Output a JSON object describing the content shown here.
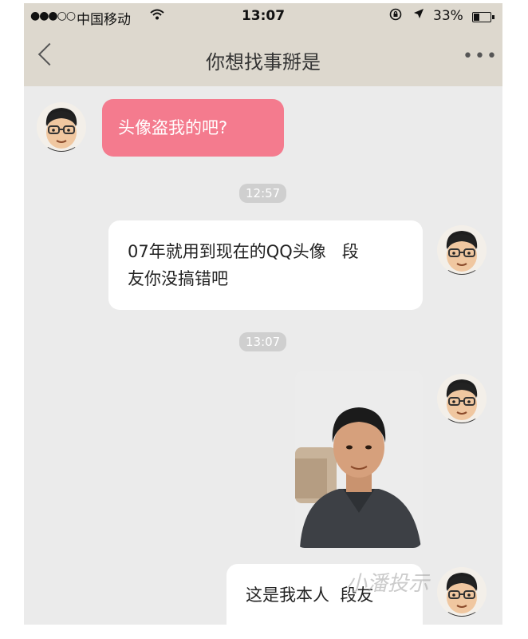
{
  "status_bar": {
    "signal": "●●●○○",
    "carrier": "中国移动",
    "time": "13:07",
    "battery": "33%",
    "battery_level": 0.33
  },
  "nav": {
    "title": "你想找事掰是"
  },
  "messages": [
    {
      "side": "left",
      "type": "text",
      "text": "头像盗我的吧?"
    },
    {
      "type": "timestamp",
      "text": "12:57"
    },
    {
      "side": "right",
      "type": "text",
      "line1": "07年就用到现在的QQ头像   段",
      "line2": "友你没搞错吧"
    },
    {
      "type": "timestamp",
      "text": "13:07"
    },
    {
      "side": "right",
      "type": "image"
    },
    {
      "side": "right",
      "type": "text",
      "text": "这是我本人  段友"
    }
  ],
  "watermark": "小潘投示",
  "colors": {
    "header_bg": "#ddd8ce",
    "chat_bg": "#ebebeb",
    "incoming_bubble": "#f47b8e",
    "outgoing_bubble": "#ffffff"
  },
  "icons": [
    "wifi-icon",
    "lock-rotation-icon",
    "location-icon",
    "battery-icon",
    "back-chevron-icon",
    "more-icon"
  ]
}
